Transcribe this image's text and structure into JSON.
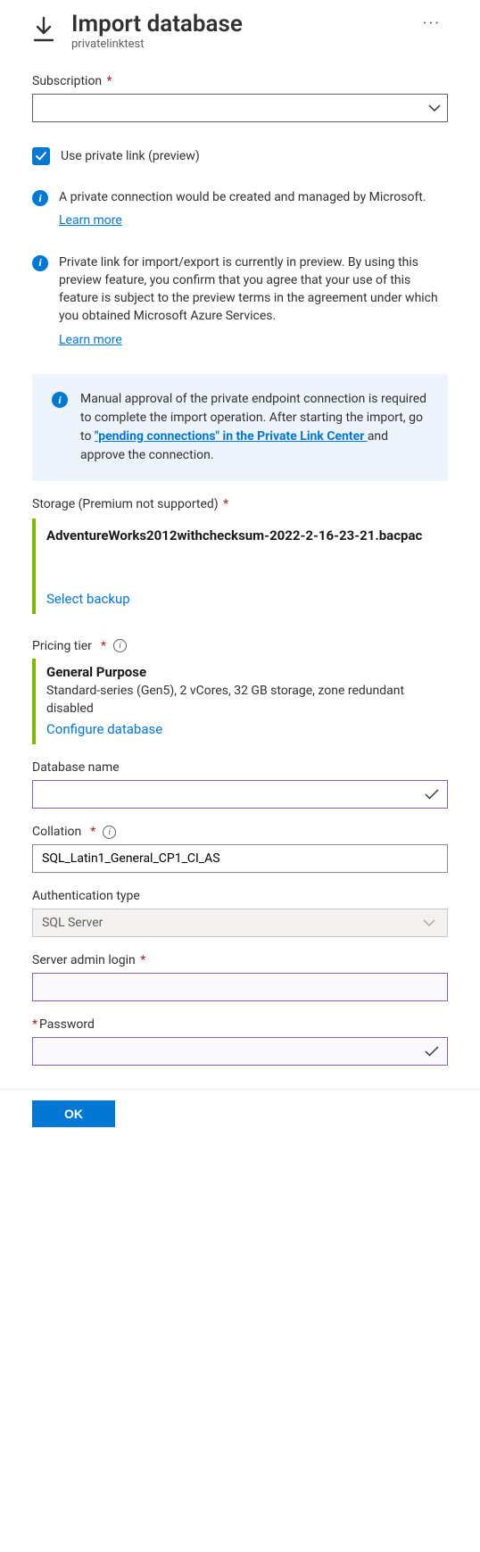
{
  "header": {
    "title": "Import database",
    "subtitle": "privatelinktest"
  },
  "subscription": {
    "label": "Subscription",
    "value": ""
  },
  "private_link": {
    "checkbox_label": "Use private link (preview)",
    "info1": "A private connection would be created and managed by Microsoft.",
    "learn1": "Learn more",
    "info2": "Private link for import/export is currently in preview. By using this preview feature, you confirm that you agree that your use of this feature is subject to the preview terms in the agreement under which you obtained Microsoft Azure Services.",
    "learn2": "Learn more"
  },
  "callout": {
    "text_before": "Manual approval of the private endpoint connection is required to complete the import operation. After starting the import, go to ",
    "link_text": "\"pending connections\" in the Private Link Center ",
    "text_after": "and approve the connection."
  },
  "storage": {
    "label": "Storage (Premium not supported)",
    "file_name": "AdventureWorks2012withchecksum-2022-2-16-23-21.bacpac",
    "action": "Select backup"
  },
  "pricing": {
    "label": "Pricing tier",
    "tier_title": "General Purpose",
    "tier_desc": "Standard-series (Gen5), 2 vCores, 32 GB storage, zone redundant disabled",
    "action": "Configure database"
  },
  "database_name": {
    "label": "Database name",
    "value": ""
  },
  "collation": {
    "label": "Collation",
    "value": "SQL_Latin1_General_CP1_CI_AS"
  },
  "auth_type": {
    "label": "Authentication type",
    "value": "SQL Server"
  },
  "server_login": {
    "label": "Server admin login",
    "value": ""
  },
  "password": {
    "label": "Password",
    "value": ""
  },
  "buttons": {
    "ok": "OK"
  }
}
